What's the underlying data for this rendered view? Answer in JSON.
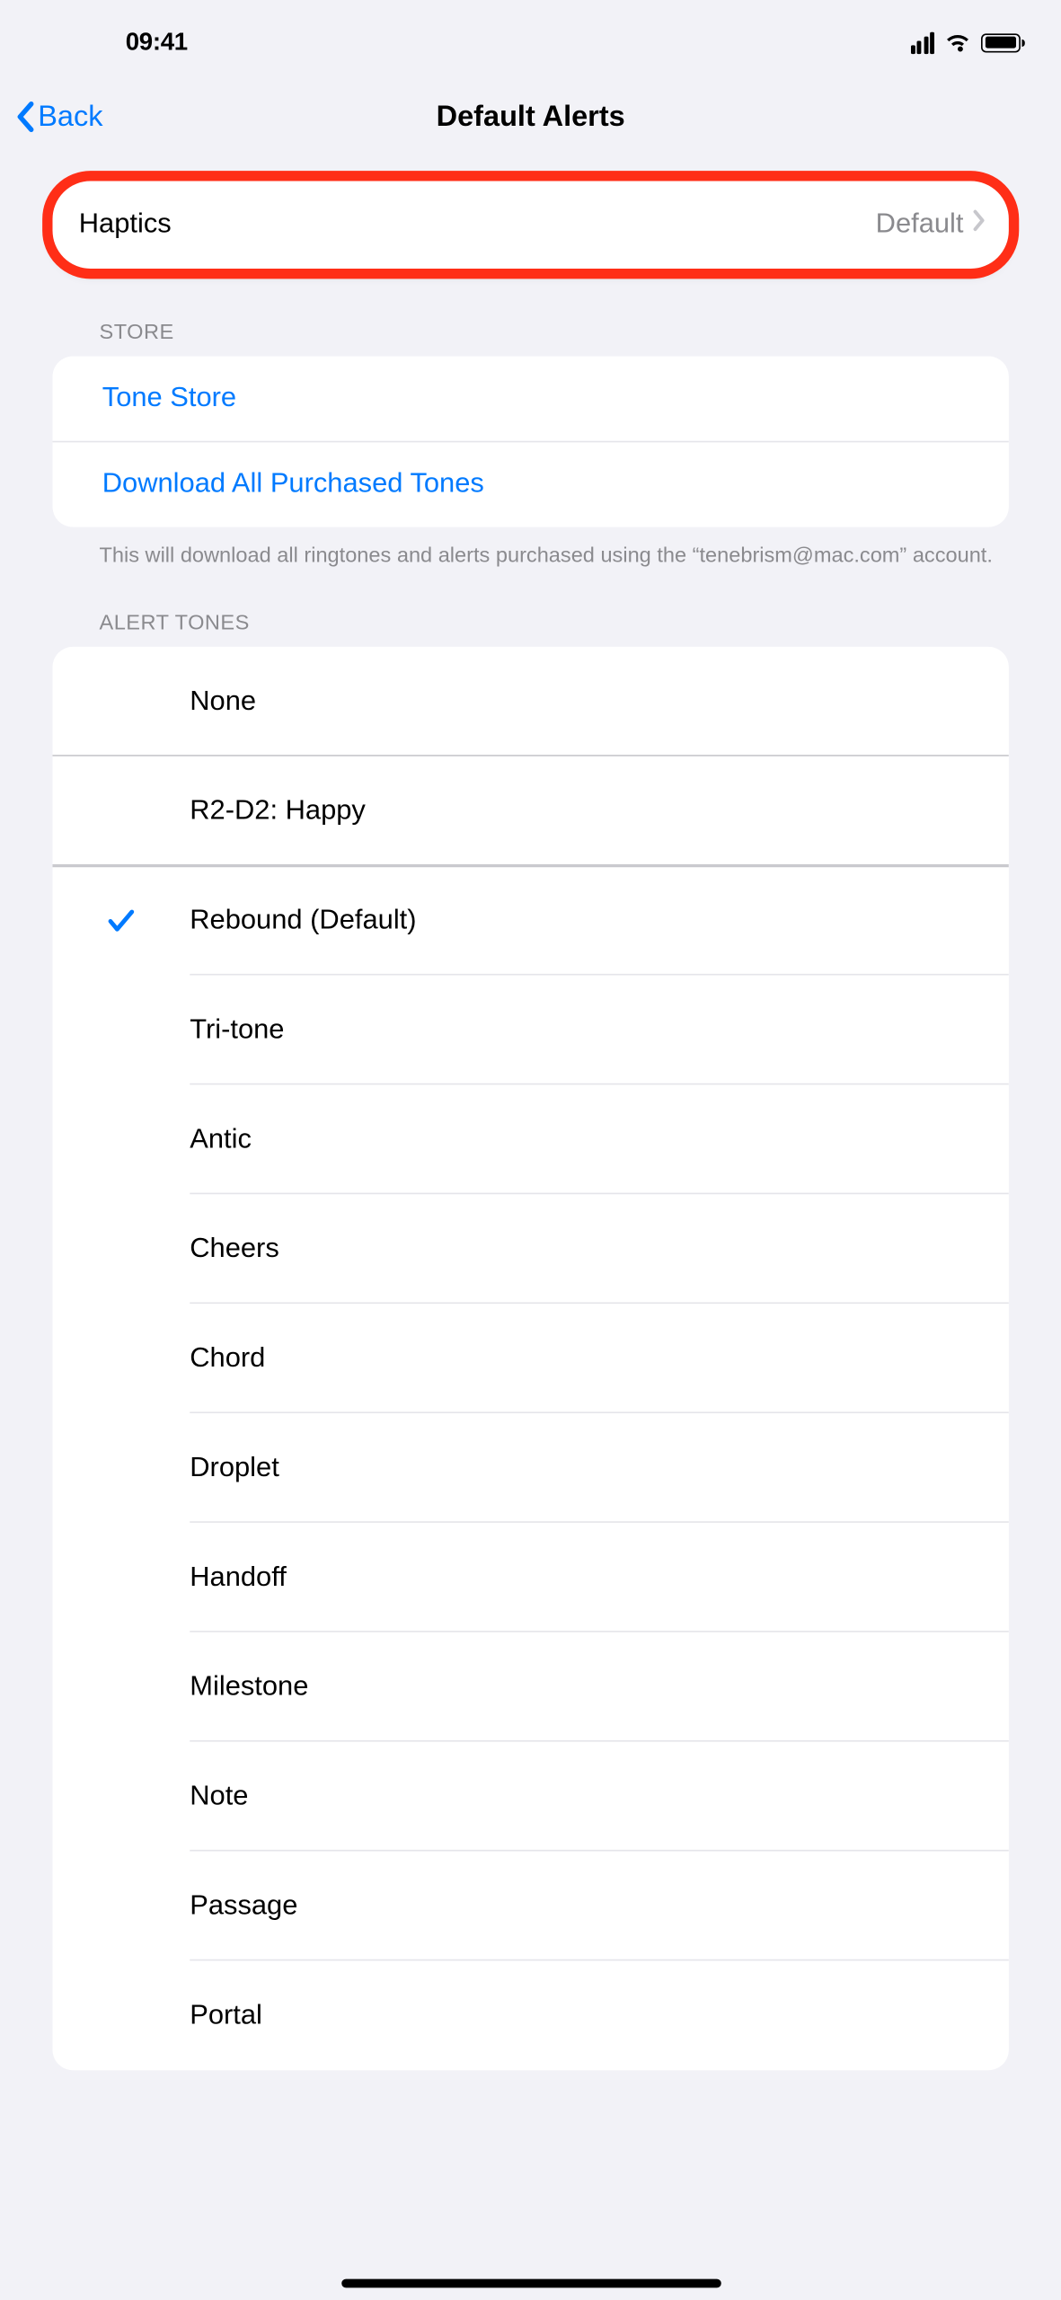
{
  "status": {
    "time": "09:41"
  },
  "nav": {
    "back": "Back",
    "title": "Default Alerts"
  },
  "haptics": {
    "label": "Haptics",
    "value": "Default"
  },
  "store": {
    "header": "Store",
    "tone_store": "Tone Store",
    "download": "Download All Purchased Tones",
    "footer": "This will download all ringtones and alerts purchased using the “tenebrism@mac.com” account."
  },
  "alerts": {
    "header": "Alert Tones",
    "selected_index": 2,
    "items": [
      "None",
      "R2-D2: Happy",
      "Rebound (Default)",
      "Tri-tone",
      "Antic",
      "Cheers",
      "Chord",
      "Droplet",
      "Handoff",
      "Milestone",
      "Note",
      "Passage",
      "Portal"
    ]
  }
}
